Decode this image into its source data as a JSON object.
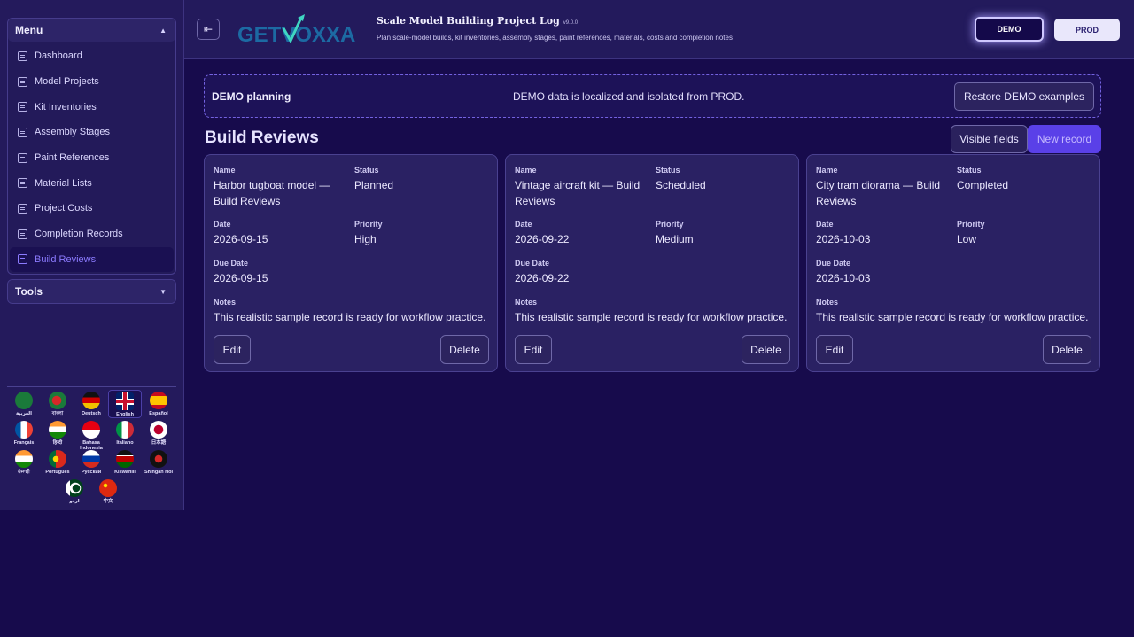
{
  "sidebar": {
    "menu_title": "Menu",
    "tools_title": "Tools",
    "items": [
      {
        "label": "Dashboard"
      },
      {
        "label": "Model Projects"
      },
      {
        "label": "Kit Inventories"
      },
      {
        "label": "Assembly Stages"
      },
      {
        "label": "Paint References"
      },
      {
        "label": "Material Lists"
      },
      {
        "label": "Project Costs"
      },
      {
        "label": "Completion Records"
      },
      {
        "label": "Build Reviews"
      }
    ],
    "active_item": "Build Reviews",
    "languages": [
      {
        "label": "العربية"
      },
      {
        "label": "বাংলা"
      },
      {
        "label": "Deutsch"
      },
      {
        "label": "English"
      },
      {
        "label": "Español"
      },
      {
        "label": "Français"
      },
      {
        "label": "हिन्दी"
      },
      {
        "label": "Bahasa Indonesia"
      },
      {
        "label": "Italiano"
      },
      {
        "label": "日本語"
      },
      {
        "label": "ਪੰਜਾਬੀ"
      },
      {
        "label": "Português"
      },
      {
        "label": "Русский"
      },
      {
        "label": "Kiswahili"
      },
      {
        "label": "Shingan Hoi"
      },
      {
        "label": "اردو"
      },
      {
        "label": "中文"
      }
    ],
    "selected_language": "English"
  },
  "header": {
    "logo_text": "GETVOXXA",
    "title": "Scale Model Building Project Log",
    "version": "v9.0.0",
    "subtitle": "Plan scale-model builds, kit inventories, assembly stages, paint references, materials, costs and completion notes",
    "demo_label": "DEMO",
    "prod_label": "PROD"
  },
  "banner": {
    "title": "DEMO planning",
    "message": "DEMO data is localized and isolated from PROD.",
    "restore_label": "Restore DEMO examples"
  },
  "section": {
    "title": "Build Reviews",
    "visible_fields_label": "Visible fields",
    "new_record_label": "New record"
  },
  "field_labels": {
    "name": "Name",
    "status": "Status",
    "date": "Date",
    "priority": "Priority",
    "due_date": "Due Date",
    "notes": "Notes"
  },
  "cards": [
    {
      "name": "Harbor tugboat model — Build Reviews",
      "status": "Planned",
      "date": "2026-09-15",
      "priority": "High",
      "due_date": "2026-09-15",
      "notes": "This realistic sample record is ready for workflow practice.",
      "edit_label": "Edit",
      "delete_label": "Delete"
    },
    {
      "name": "Vintage aircraft kit — Build Reviews",
      "status": "Scheduled",
      "date": "2026-09-22",
      "priority": "Medium",
      "due_date": "2026-09-22",
      "notes": "This realistic sample record is ready for workflow practice.",
      "edit_label": "Edit",
      "delete_label": "Delete"
    },
    {
      "name": "City tram diorama — Build Reviews",
      "status": "Completed",
      "date": "2026-10-03",
      "priority": "Low",
      "due_date": "2026-10-03",
      "notes": "This realistic sample record is ready for workflow practice.",
      "edit_label": "Edit",
      "delete_label": "Delete"
    }
  ],
  "colors": {
    "background": "#170b4c",
    "panel": "#2a2163",
    "accent": "#5a40e8",
    "active_text": "#8c7bff"
  }
}
